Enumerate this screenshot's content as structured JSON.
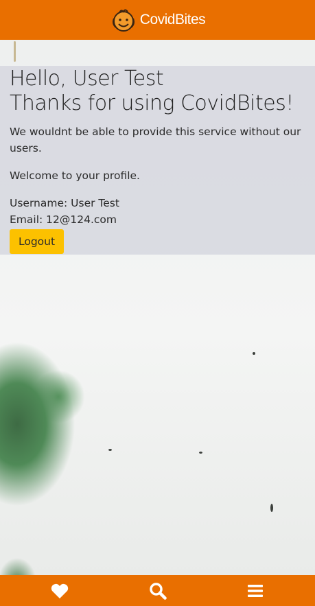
{
  "header": {
    "brand_name": "CovidBites",
    "logo_icon": "smiling-face-logo"
  },
  "profile": {
    "greeting": "Hello, User Test",
    "thanks": "Thanks for using CovidBites!",
    "intro": "We wouldnt be able to provide this service without our users.",
    "welcome": "Welcome to your profile.",
    "username_line": "Username: User Test",
    "email_line": "Email: 12@124.com",
    "logout_label": "Logout"
  },
  "bottom_nav": {
    "items": [
      {
        "icon": "heart-icon"
      },
      {
        "icon": "search-icon"
      },
      {
        "icon": "menu-icon"
      }
    ]
  },
  "colors": {
    "brand_orange": "#e96f00",
    "button_yellow": "#fcc100",
    "panel_gray": "#d8d9e1"
  }
}
